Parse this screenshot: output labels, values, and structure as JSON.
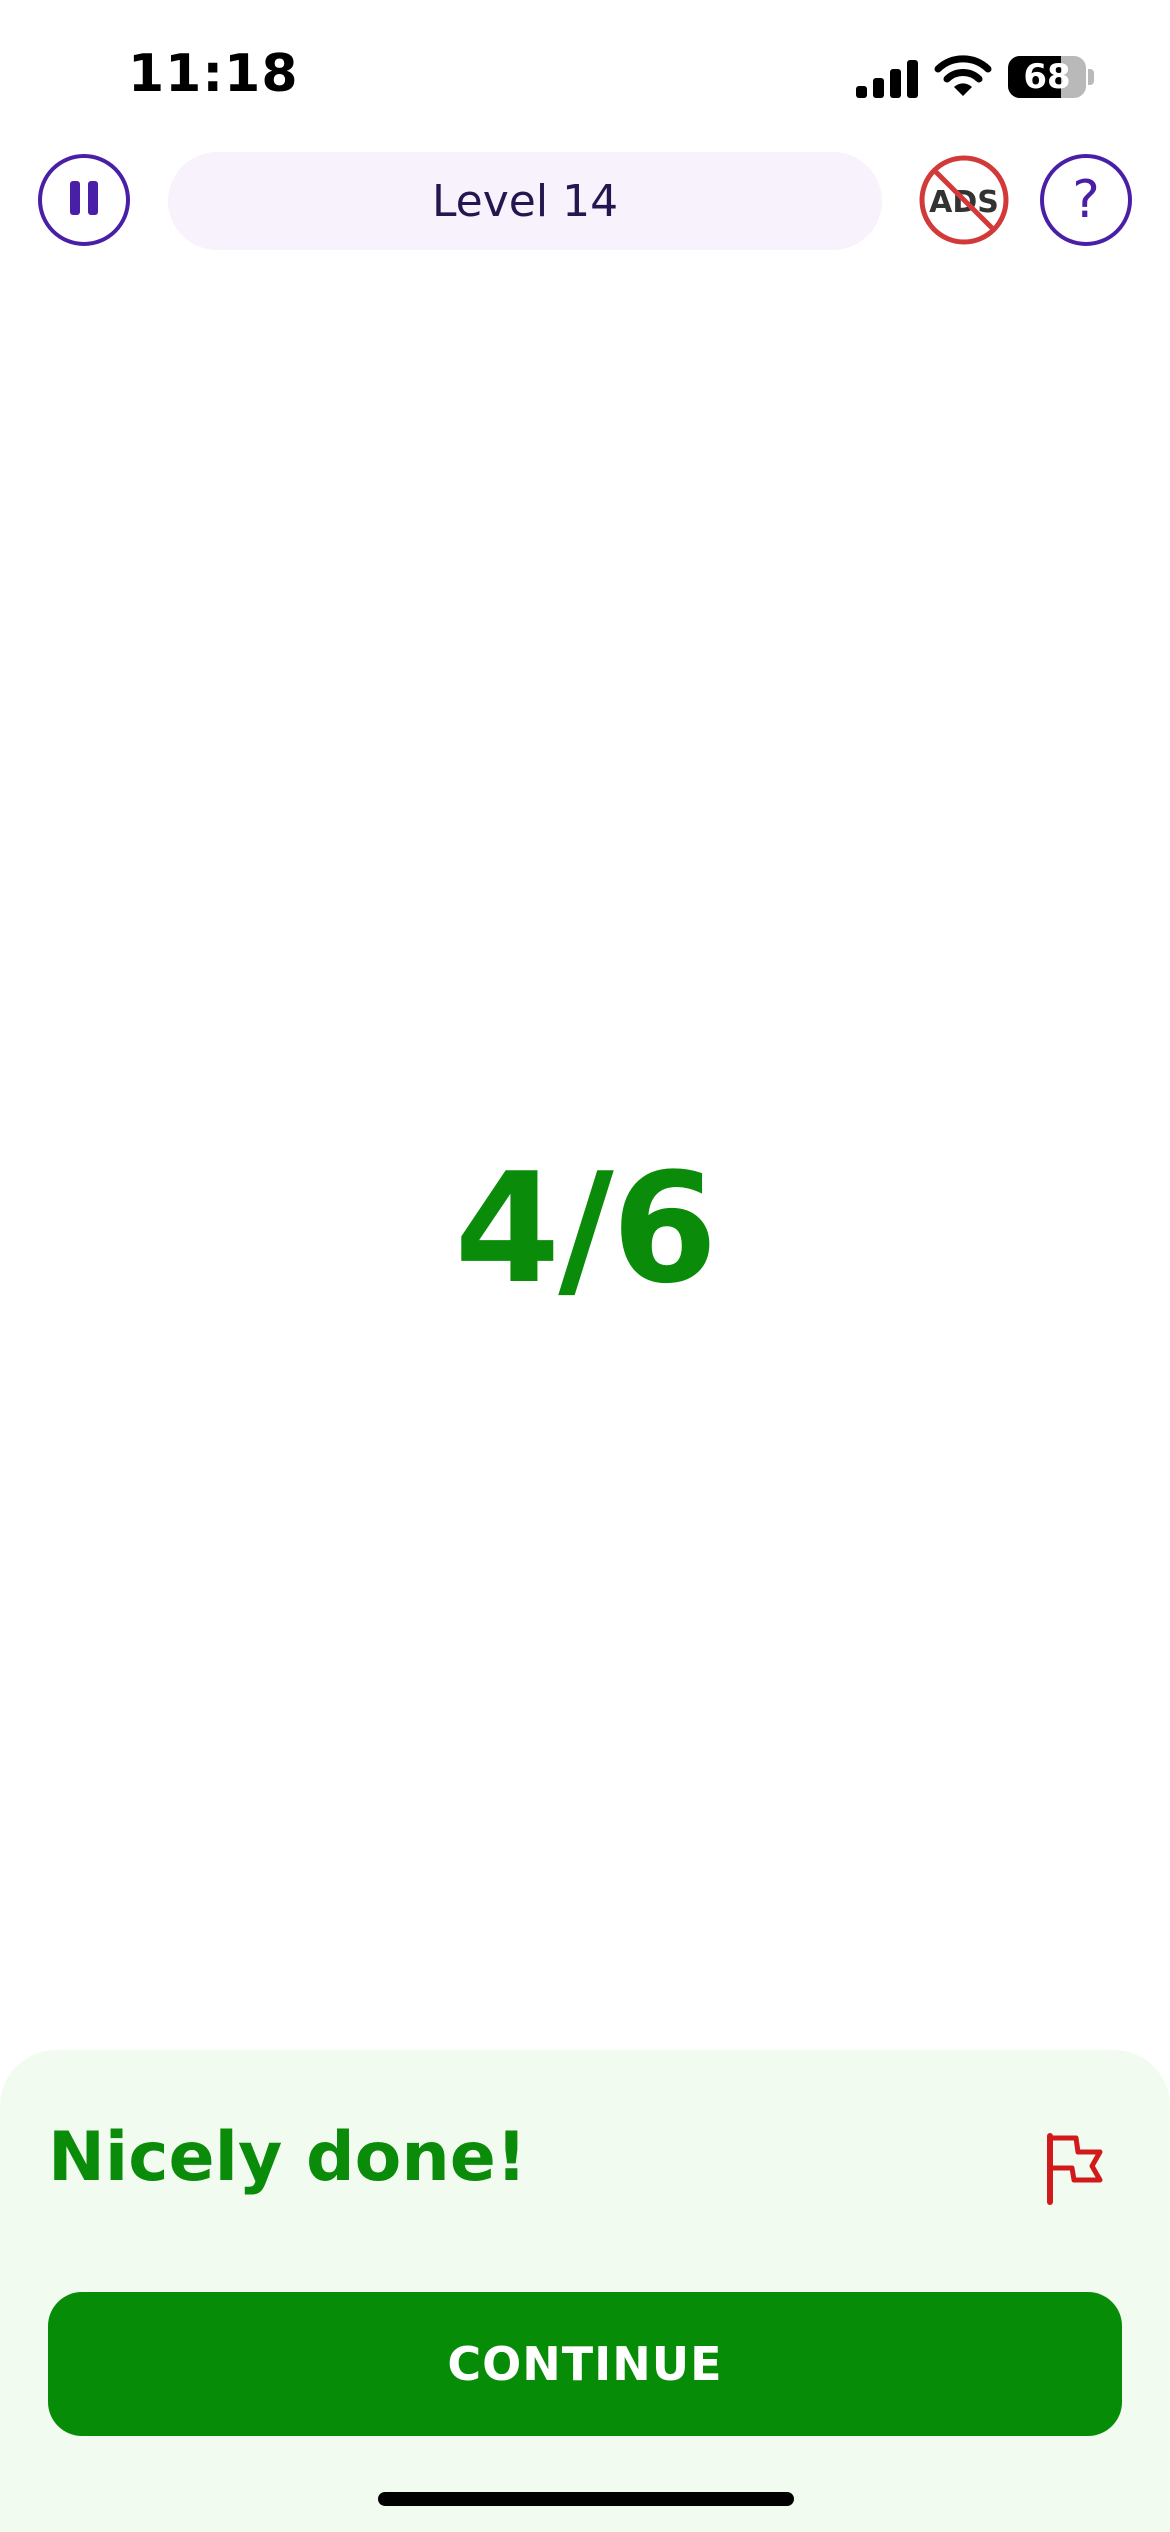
{
  "status_bar": {
    "time": "11:18",
    "battery_level": "68",
    "icons": [
      "cellular-signal-icon",
      "wifi-icon",
      "battery-icon"
    ]
  },
  "header": {
    "level_label": "Level 14",
    "icons": {
      "pause": "pause-icon",
      "no_ads": "no-ads-icon",
      "help": "help-icon"
    },
    "no_ads_text": "ADS",
    "help_text": "?"
  },
  "score": {
    "text": "4/6"
  },
  "result_sheet": {
    "feedback": "Nicely done!",
    "flag_icon": "report-flag-icon",
    "continue_label": "CONTINUE"
  },
  "colors": {
    "accent_purple": "#4a1fa8",
    "success_green": "#0a8c0a",
    "button_green": "#078c07",
    "sheet_background": "#f2fbf0",
    "flag_red": "#d11a1a",
    "no_ads_red": "#d23a3a"
  }
}
